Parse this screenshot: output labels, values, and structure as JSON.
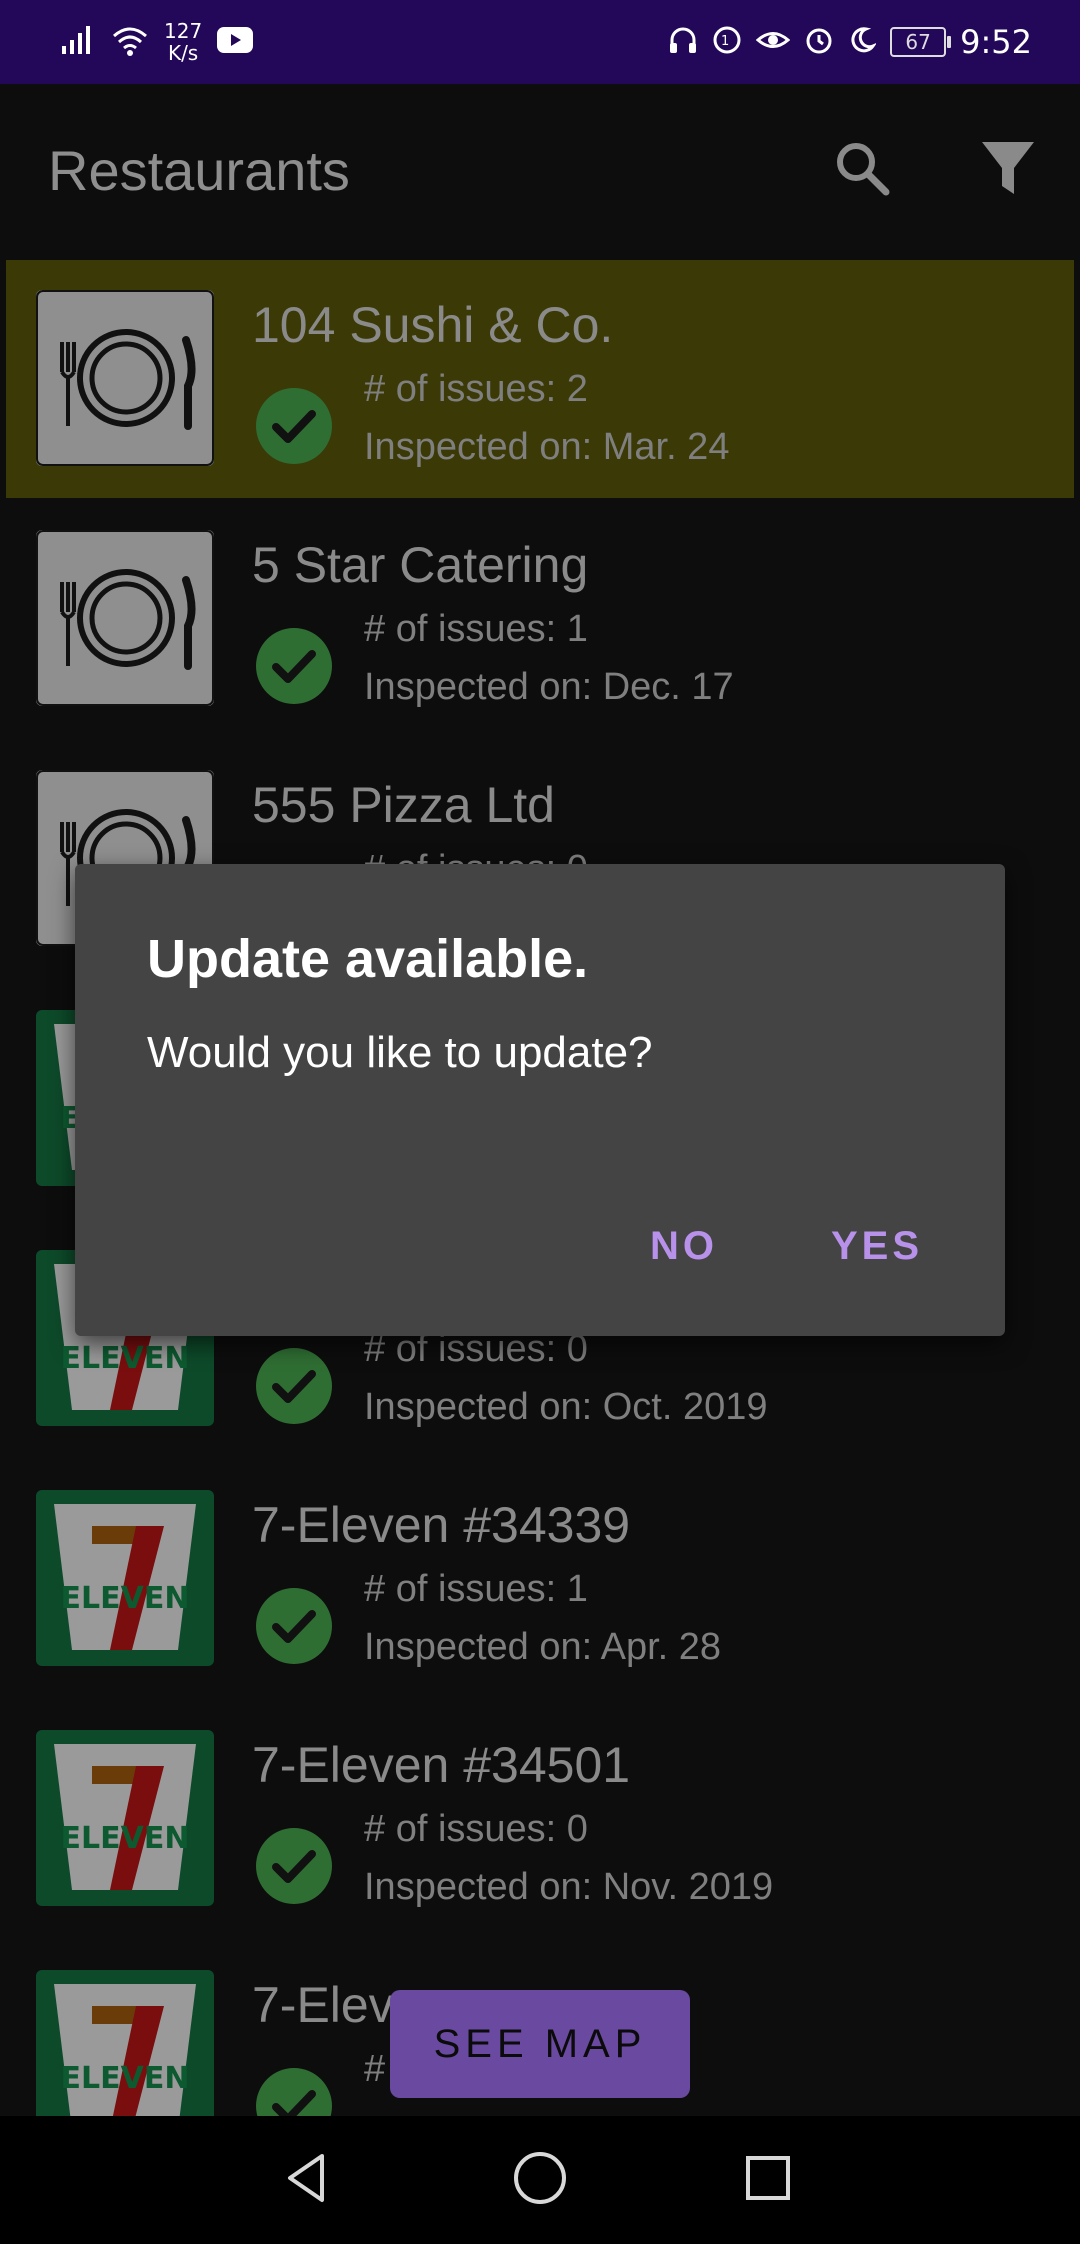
{
  "status_bar": {
    "network_speed_value": "127",
    "network_speed_unit": "K/s",
    "battery_level": "67",
    "time": "9:52"
  },
  "app_bar": {
    "title": "Restaurants",
    "search_icon": "search-icon",
    "filter_icon": "filter-icon"
  },
  "restaurants": [
    {
      "name": "104 Sushi & Co.",
      "issues": "# of issues: 2",
      "inspected": "Inspected on: Mar. 24",
      "logo": "plate-icon",
      "highlighted": true
    },
    {
      "name": "5 Star Catering",
      "issues": "# of issues: 1",
      "inspected": "Inspected on: Dec. 17",
      "logo": "plate-icon",
      "highlighted": false
    },
    {
      "name": "555 Pizza Ltd",
      "issues": "# of issues: 0",
      "inspected": "",
      "logo": "plate-icon",
      "highlighted": false
    },
    {
      "name": "",
      "issues": "",
      "inspected": "",
      "logo": "seven-eleven-logo",
      "highlighted": false
    },
    {
      "name": "",
      "issues": "# of issues: 0",
      "inspected": "Inspected on: Oct. 2019",
      "logo": "seven-eleven-logo",
      "highlighted": false
    },
    {
      "name": "7-Eleven #34339",
      "issues": "# of issues: 1",
      "inspected": "Inspected on: Apr. 28",
      "logo": "seven-eleven-logo",
      "highlighted": false
    },
    {
      "name": "7-Eleven #34501",
      "issues": "# of issues: 0",
      "inspected": "Inspected on: Nov. 2019",
      "logo": "seven-eleven-logo",
      "highlighted": false
    },
    {
      "name": "7-Elev",
      "issues": "#",
      "inspected": "",
      "logo": "seven-eleven-logo",
      "highlighted": false
    }
  ],
  "see_map_label": "SEE MAP",
  "dialog": {
    "title": "Update available.",
    "message": "Would you like to update?",
    "no_label": "NO",
    "yes_label": "YES"
  },
  "colors": {
    "status_bar": "#23085a",
    "highlight_row": "#3b3a06",
    "check": "#2f6e33",
    "dialog_bg": "#444444",
    "dialog_button": "#b891ea",
    "see_map_button": "#6a4aa0"
  }
}
